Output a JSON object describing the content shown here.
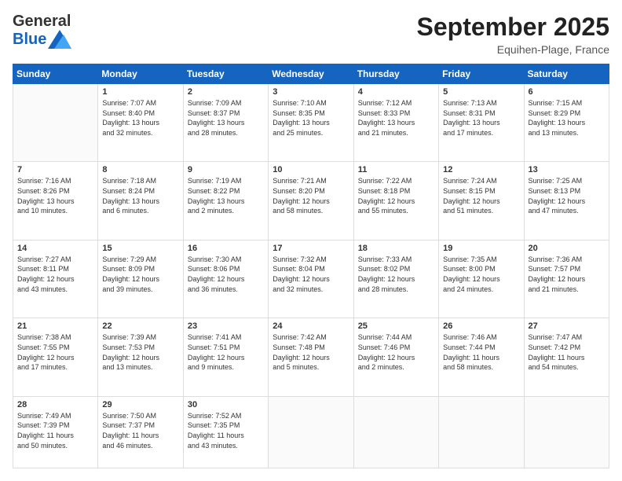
{
  "header": {
    "logo_line1": "General",
    "logo_line2": "Blue",
    "month": "September 2025",
    "location": "Equihen-Plage, France"
  },
  "days_of_week": [
    "Sunday",
    "Monday",
    "Tuesday",
    "Wednesday",
    "Thursday",
    "Friday",
    "Saturday"
  ],
  "weeks": [
    [
      {
        "day": "",
        "text": ""
      },
      {
        "day": "1",
        "text": "Sunrise: 7:07 AM\nSunset: 8:40 PM\nDaylight: 13 hours\nand 32 minutes."
      },
      {
        "day": "2",
        "text": "Sunrise: 7:09 AM\nSunset: 8:37 PM\nDaylight: 13 hours\nand 28 minutes."
      },
      {
        "day": "3",
        "text": "Sunrise: 7:10 AM\nSunset: 8:35 PM\nDaylight: 13 hours\nand 25 minutes."
      },
      {
        "day": "4",
        "text": "Sunrise: 7:12 AM\nSunset: 8:33 PM\nDaylight: 13 hours\nand 21 minutes."
      },
      {
        "day": "5",
        "text": "Sunrise: 7:13 AM\nSunset: 8:31 PM\nDaylight: 13 hours\nand 17 minutes."
      },
      {
        "day": "6",
        "text": "Sunrise: 7:15 AM\nSunset: 8:29 PM\nDaylight: 13 hours\nand 13 minutes."
      }
    ],
    [
      {
        "day": "7",
        "text": "Sunrise: 7:16 AM\nSunset: 8:26 PM\nDaylight: 13 hours\nand 10 minutes."
      },
      {
        "day": "8",
        "text": "Sunrise: 7:18 AM\nSunset: 8:24 PM\nDaylight: 13 hours\nand 6 minutes."
      },
      {
        "day": "9",
        "text": "Sunrise: 7:19 AM\nSunset: 8:22 PM\nDaylight: 13 hours\nand 2 minutes."
      },
      {
        "day": "10",
        "text": "Sunrise: 7:21 AM\nSunset: 8:20 PM\nDaylight: 12 hours\nand 58 minutes."
      },
      {
        "day": "11",
        "text": "Sunrise: 7:22 AM\nSunset: 8:18 PM\nDaylight: 12 hours\nand 55 minutes."
      },
      {
        "day": "12",
        "text": "Sunrise: 7:24 AM\nSunset: 8:15 PM\nDaylight: 12 hours\nand 51 minutes."
      },
      {
        "day": "13",
        "text": "Sunrise: 7:25 AM\nSunset: 8:13 PM\nDaylight: 12 hours\nand 47 minutes."
      }
    ],
    [
      {
        "day": "14",
        "text": "Sunrise: 7:27 AM\nSunset: 8:11 PM\nDaylight: 12 hours\nand 43 minutes."
      },
      {
        "day": "15",
        "text": "Sunrise: 7:29 AM\nSunset: 8:09 PM\nDaylight: 12 hours\nand 39 minutes."
      },
      {
        "day": "16",
        "text": "Sunrise: 7:30 AM\nSunset: 8:06 PM\nDaylight: 12 hours\nand 36 minutes."
      },
      {
        "day": "17",
        "text": "Sunrise: 7:32 AM\nSunset: 8:04 PM\nDaylight: 12 hours\nand 32 minutes."
      },
      {
        "day": "18",
        "text": "Sunrise: 7:33 AM\nSunset: 8:02 PM\nDaylight: 12 hours\nand 28 minutes."
      },
      {
        "day": "19",
        "text": "Sunrise: 7:35 AM\nSunset: 8:00 PM\nDaylight: 12 hours\nand 24 minutes."
      },
      {
        "day": "20",
        "text": "Sunrise: 7:36 AM\nSunset: 7:57 PM\nDaylight: 12 hours\nand 21 minutes."
      }
    ],
    [
      {
        "day": "21",
        "text": "Sunrise: 7:38 AM\nSunset: 7:55 PM\nDaylight: 12 hours\nand 17 minutes."
      },
      {
        "day": "22",
        "text": "Sunrise: 7:39 AM\nSunset: 7:53 PM\nDaylight: 12 hours\nand 13 minutes."
      },
      {
        "day": "23",
        "text": "Sunrise: 7:41 AM\nSunset: 7:51 PM\nDaylight: 12 hours\nand 9 minutes."
      },
      {
        "day": "24",
        "text": "Sunrise: 7:42 AM\nSunset: 7:48 PM\nDaylight: 12 hours\nand 5 minutes."
      },
      {
        "day": "25",
        "text": "Sunrise: 7:44 AM\nSunset: 7:46 PM\nDaylight: 12 hours\nand 2 minutes."
      },
      {
        "day": "26",
        "text": "Sunrise: 7:46 AM\nSunset: 7:44 PM\nDaylight: 11 hours\nand 58 minutes."
      },
      {
        "day": "27",
        "text": "Sunrise: 7:47 AM\nSunset: 7:42 PM\nDaylight: 11 hours\nand 54 minutes."
      }
    ],
    [
      {
        "day": "28",
        "text": "Sunrise: 7:49 AM\nSunset: 7:39 PM\nDaylight: 11 hours\nand 50 minutes."
      },
      {
        "day": "29",
        "text": "Sunrise: 7:50 AM\nSunset: 7:37 PM\nDaylight: 11 hours\nand 46 minutes."
      },
      {
        "day": "30",
        "text": "Sunrise: 7:52 AM\nSunset: 7:35 PM\nDaylight: 11 hours\nand 43 minutes."
      },
      {
        "day": "",
        "text": ""
      },
      {
        "day": "",
        "text": ""
      },
      {
        "day": "",
        "text": ""
      },
      {
        "day": "",
        "text": ""
      }
    ]
  ]
}
